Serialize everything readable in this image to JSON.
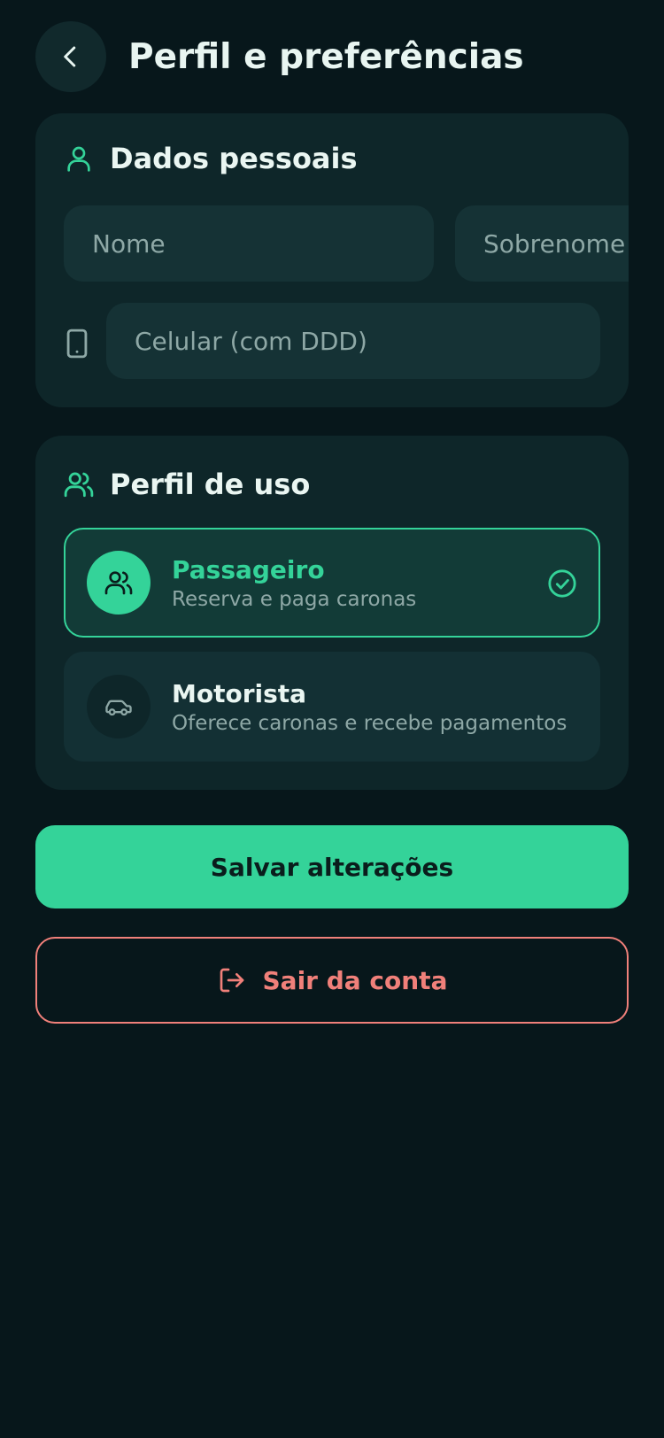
{
  "header": {
    "title": "Perfil e preferências",
    "back_icon": "chevron-left-icon"
  },
  "personal_data": {
    "title": "Dados pessoais",
    "icon": "user-icon",
    "first_name": {
      "value": "",
      "placeholder": "Nome"
    },
    "last_name": {
      "value": "",
      "placeholder": "Sobrenome"
    },
    "phone": {
      "value": "",
      "placeholder": "Celular (com DDD)",
      "icon": "smartphone-icon"
    }
  },
  "usage_profile": {
    "title": "Perfil de uso",
    "icon": "users-icon",
    "options": [
      {
        "name": "Passageiro",
        "description": "Reserva e paga caronas",
        "icon": "users-icon",
        "selected": true
      },
      {
        "name": "Motorista",
        "description": "Oferece caronas e recebe pagamentos",
        "icon": "car-icon",
        "selected": false
      }
    ]
  },
  "actions": {
    "save_label": "Salvar alterações",
    "logout_label": "Sair da conta",
    "logout_icon": "log-out-icon"
  },
  "colors": {
    "background": "#07171b",
    "card": "#0e2629",
    "accent": "#34d399",
    "danger": "#f0807a"
  }
}
